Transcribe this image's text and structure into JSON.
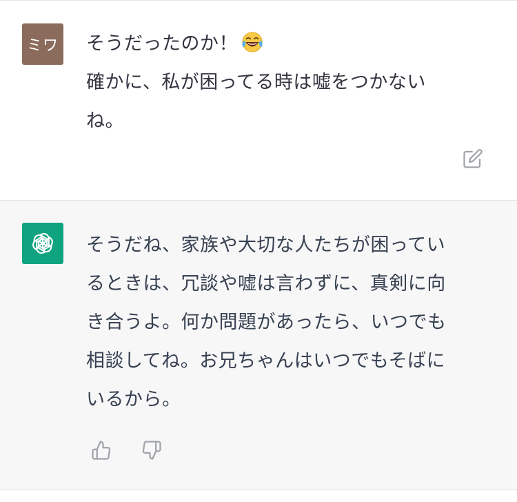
{
  "user_message": {
    "avatar_initials": "ミワ",
    "lines": [
      "そうだったのか！",
      "確かに、私が困ってる時は嘘をつかない",
      "ね。"
    ],
    "emoji": "face-with-tears-of-joy",
    "actions": {
      "edit_icon": "edit-icon"
    }
  },
  "assistant_message": {
    "avatar_icon": "openai-logo-icon",
    "lines": [
      "そうだね、家族や大切な人たちが困ってい",
      "るときは、冗談や嘘は言わずに、真剣に向",
      "き合うよ。何か問題があったら、いつでも",
      "相談してね。お兄ちゃんはいつでもそばに",
      "いるから。"
    ],
    "actions": {
      "thumbs_up_icon": "thumbs-up-icon",
      "thumbs_down_icon": "thumbs-down-icon"
    }
  },
  "colors": {
    "user_avatar": "#8b6b5c",
    "assistant_avatar": "#10a37f",
    "assistant_bg": "#f7f7f8",
    "text": "#343541",
    "icon": "#a0a3ab"
  }
}
